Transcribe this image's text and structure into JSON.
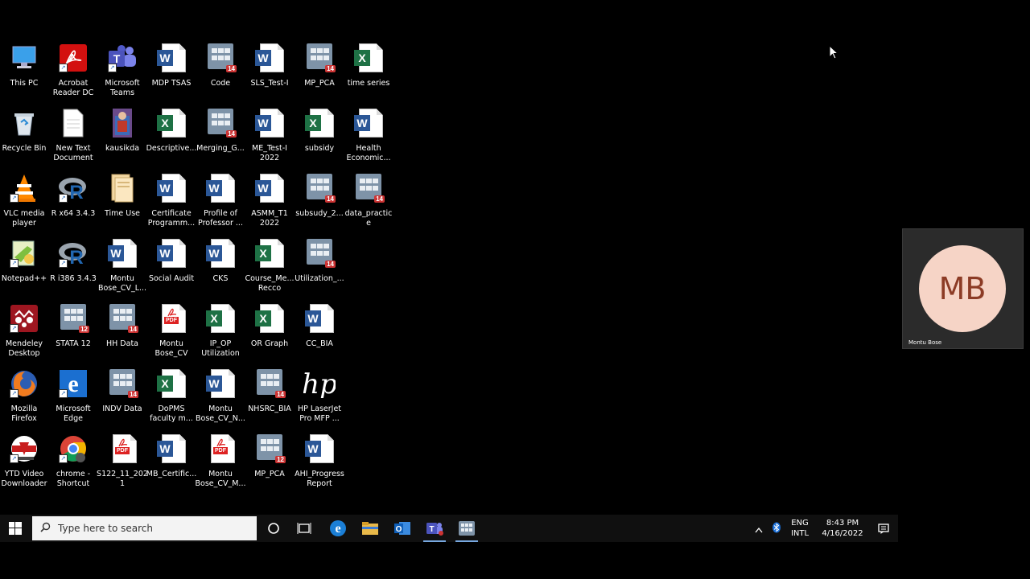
{
  "desktop": {
    "icons": [
      {
        "id": "this-pc",
        "label": "This PC",
        "type": "pc"
      },
      {
        "id": "acrobat",
        "label": "Acrobat\nReader DC",
        "type": "acrobat"
      },
      {
        "id": "teams",
        "label": "Microsoft\nTeams",
        "type": "teams"
      },
      {
        "id": "mdp-tsas",
        "label": "MDP TSAS",
        "type": "word"
      },
      {
        "id": "code",
        "label": "Code",
        "type": "stata",
        "badge": "14"
      },
      {
        "id": "sls-test",
        "label": "SLS_Test-I",
        "type": "word"
      },
      {
        "id": "mp-pca-1",
        "label": "MP_PCA",
        "type": "stata",
        "badge": "14"
      },
      {
        "id": "time-series",
        "label": "time series",
        "type": "excel"
      },
      {
        "id": "recycle-bin",
        "label": "Recycle Bin",
        "type": "bin"
      },
      {
        "id": "new-text",
        "label": "New Text\nDocument",
        "type": "text"
      },
      {
        "id": "kausikda",
        "label": "kausikda",
        "type": "image"
      },
      {
        "id": "descriptive",
        "label": "Descriptive...",
        "type": "excel"
      },
      {
        "id": "merging",
        "label": "Merging_G...",
        "type": "stata",
        "badge": "14"
      },
      {
        "id": "me-test",
        "label": "ME_Test-I\n2022",
        "type": "word"
      },
      {
        "id": "subsidy",
        "label": "subsidy",
        "type": "excel"
      },
      {
        "id": "health-econ",
        "label": "Health\nEconomic...",
        "type": "word"
      },
      {
        "id": "vlc",
        "label": "VLC media\nplayer",
        "type": "vlc"
      },
      {
        "id": "r-x64",
        "label": "R x64 3.4.3",
        "type": "r"
      },
      {
        "id": "time-use",
        "label": "Time Use",
        "type": "folder"
      },
      {
        "id": "certificate",
        "label": "Certificate\nProgramm...",
        "type": "word"
      },
      {
        "id": "profile",
        "label": "Profile of\nProfessor ...",
        "type": "word"
      },
      {
        "id": "asmm",
        "label": "ASMM_T1\n2022",
        "type": "word"
      },
      {
        "id": "subsudy2",
        "label": "subsudy_2...",
        "type": "stata",
        "badge": "14"
      },
      {
        "id": "data-practice",
        "label": "data_practice",
        "type": "stata",
        "badge": "14"
      },
      {
        "id": "notepadpp",
        "label": "Notepad++",
        "type": "notepad"
      },
      {
        "id": "r-i386",
        "label": "R i386 3.4.3",
        "type": "r"
      },
      {
        "id": "montu-cv-l",
        "label": "Montu\nBose_CV_L...",
        "type": "word"
      },
      {
        "id": "social-audit",
        "label": "Social Audit",
        "type": "word"
      },
      {
        "id": "cks",
        "label": "CKS",
        "type": "word"
      },
      {
        "id": "course-me",
        "label": "Course_Me...\nRecco",
        "type": "excel"
      },
      {
        "id": "utilization",
        "label": "Utilization_...",
        "type": "stata",
        "badge": "14"
      },
      {
        "id": "mendeley",
        "label": "Mendeley\nDesktop",
        "type": "mendeley"
      },
      {
        "id": "stata12",
        "label": "STATA 12",
        "type": "stata",
        "badge": "12"
      },
      {
        "id": "hh-data",
        "label": "HH Data",
        "type": "stata",
        "badge": "14"
      },
      {
        "id": "montu-cv-pdf",
        "label": "Montu\nBose_CV",
        "type": "pdf"
      },
      {
        "id": "ip-op",
        "label": "IP_OP\nUtilization",
        "type": "excel"
      },
      {
        "id": "or-graph",
        "label": "OR Graph",
        "type": "excel"
      },
      {
        "id": "cc-bia",
        "label": "CC_BIA",
        "type": "word"
      },
      {
        "id": "firefox",
        "label": "Mozilla\nFirefox",
        "type": "firefox"
      },
      {
        "id": "edge",
        "label": "Microsoft\nEdge",
        "type": "edge"
      },
      {
        "id": "indv-data",
        "label": "INDV Data",
        "type": "stata",
        "badge": "14"
      },
      {
        "id": "dopms",
        "label": "DoPMS\nfaculty m...",
        "type": "excel"
      },
      {
        "id": "montu-cv-n",
        "label": "Montu\nBose_CV_N...",
        "type": "word"
      },
      {
        "id": "nhsrc-bia",
        "label": "NHSRC_BIA",
        "type": "stata",
        "badge": "14"
      },
      {
        "id": "hp-laserjet",
        "label": "HP LaserJet\nPro MFP ...",
        "type": "hp"
      },
      {
        "id": "ytd",
        "label": "YTD Video\nDownloader",
        "type": "ytd"
      },
      {
        "id": "chrome",
        "label": "chrome -\nShortcut",
        "type": "chrome"
      },
      {
        "id": "s122",
        "label": "S122_11_2021",
        "type": "pdf"
      },
      {
        "id": "mb-certific",
        "label": "MB_Certific...",
        "type": "word"
      },
      {
        "id": "montu-cv-m",
        "label": "Montu\nBose_CV_M...",
        "type": "pdf"
      },
      {
        "id": "mp-pca-2",
        "label": "MP_PCA",
        "type": "stata",
        "badge": "12"
      },
      {
        "id": "ahi-progress",
        "label": "AHI_Progress\nReport",
        "type": "word"
      }
    ]
  },
  "taskbar": {
    "search_placeholder": "Type here to search",
    "lang_top": "ENG",
    "lang_bottom": "INTL",
    "time": "8:43 PM",
    "date": "4/16/2022"
  },
  "meeting": {
    "initials": "MB",
    "participant": "Montu Bose"
  },
  "colors": {
    "word": "#2b5797",
    "excel": "#1e7145",
    "pdf": "#d22222",
    "avatar_bg": "#f6d4c6",
    "avatar_text": "#8c3b25"
  }
}
